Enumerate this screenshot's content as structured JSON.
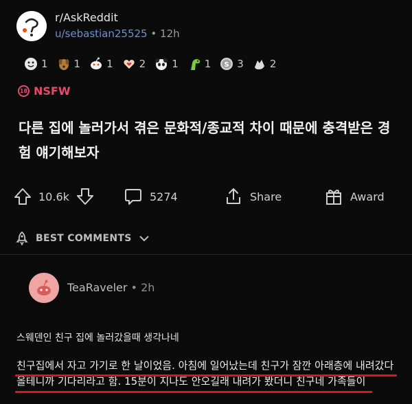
{
  "post": {
    "subreddit": "r/AskReddit",
    "author": "u/sebastian25525",
    "separator": "•",
    "time": "12h",
    "flair": "NSFW",
    "title": "다른 집에 놀러가서 겪은 문화적/종교적 차이 때문에 충격받은 경험 얘기해보자"
  },
  "awards": [
    {
      "icon": "wholesome-award-icon",
      "count": "1"
    },
    {
      "icon": "dog-award-icon",
      "count": "1"
    },
    {
      "icon": "snoo-award-icon",
      "count": "1"
    },
    {
      "icon": "heart-hands-award-icon",
      "count": "2"
    },
    {
      "icon": "panda-award-icon",
      "count": "1"
    },
    {
      "icon": "dino-award-icon",
      "count": "1"
    },
    {
      "icon": "silver-award-icon",
      "count": "3"
    },
    {
      "icon": "hand-award-icon",
      "count": "2"
    }
  ],
  "actions": {
    "votes": "10.6k",
    "comments": "5274",
    "share": "Share",
    "award": "Award"
  },
  "sort": {
    "label": "BEST COMMENTS"
  },
  "comment": {
    "author": "TeaRaveler",
    "separator": "•",
    "time": "2h",
    "line1": "스웨덴인 친구 집에 놀러갔을때 생각나네",
    "line2": "친구집에서 자고 가기로 한 날이었음. 아침에 일어났는데 친구가 잠깐 아래층에 내려갔다",
    "line3": "올테니까 기다리라고 함. 15분이 지나도 안오길래 내려가 봤더니 친구네 가족들이"
  },
  "colors": {
    "background": "#0b0b0b",
    "nsfw": "#e64a6a",
    "username": "#6d8fd6",
    "highlight_underline": "#e0141e"
  }
}
